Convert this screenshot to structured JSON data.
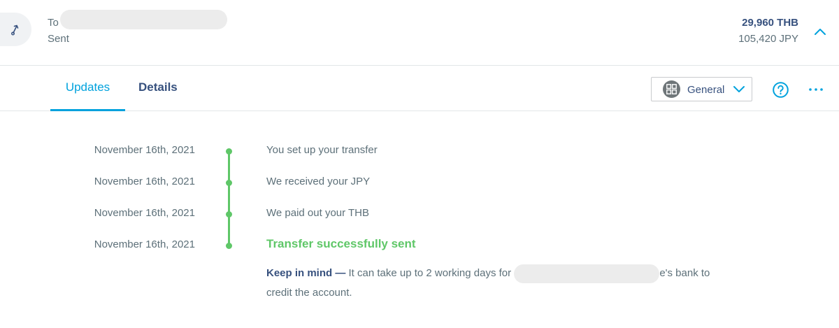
{
  "transfer": {
    "to_label": "To",
    "status": "Sent",
    "amount_received": "29,960 THB",
    "amount_sent": "105,420 JPY"
  },
  "tabs": [
    {
      "label": "Updates",
      "active": true
    },
    {
      "label": "Details",
      "active": false
    }
  ],
  "category": {
    "label": "General",
    "icon": "grid-category-icon"
  },
  "icons": {
    "avatar": "arrow-up-right-icon",
    "collapse": "chevron-up-icon",
    "help": "help-circle-icon",
    "more": "more-horizontal-icon"
  },
  "timeline": [
    {
      "date": "November 16th, 2021",
      "text": "You set up your transfer"
    },
    {
      "date": "November 16th, 2021",
      "text": "We received your JPY"
    },
    {
      "date": "November 16th, 2021",
      "text": "We paid out your THB"
    },
    {
      "date": "November 16th, 2021",
      "text": "Transfer successfully sent"
    }
  ],
  "note": {
    "title": "Keep in mind —",
    "before_redaction": "It can take up to 2 working days for",
    "after_redaction": "e's bank to",
    "line2": "credit the account."
  },
  "colors": {
    "accent": "#00a2dd",
    "success": "#5fc768",
    "text_primary": "#37517e",
    "text_secondary": "#5d7079",
    "border": "#e2e6e8"
  }
}
